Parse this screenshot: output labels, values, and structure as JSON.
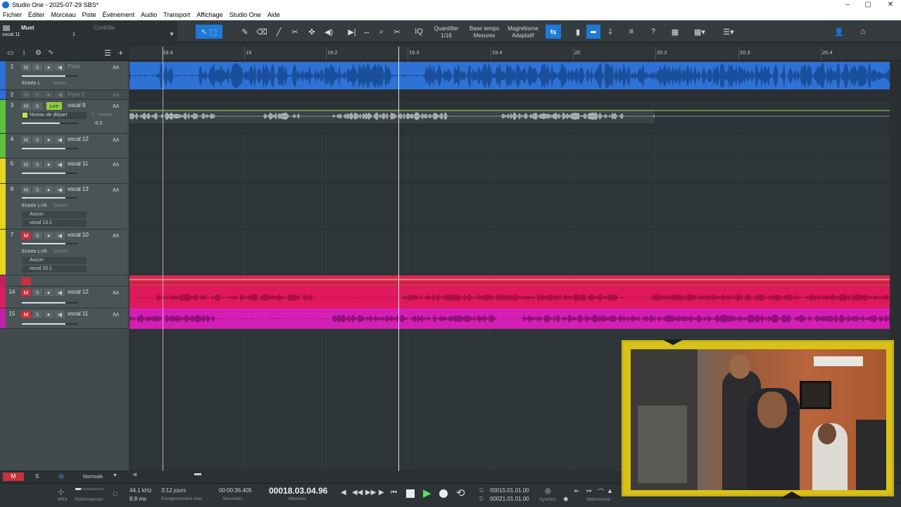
{
  "window": {
    "title": "Studio One - 2025-07-29 SBS*",
    "minimize": "–",
    "maximize": "▢",
    "close": "✕"
  },
  "menu": [
    "Fichier",
    "Éditer",
    "Morceau",
    "Piste",
    "Événement",
    "Audio",
    "Transport",
    "Affichage",
    "Studio One",
    "Aide"
  ],
  "track_selector": {
    "mute_label": "Muet",
    "track_name": "vocal 11",
    "count": "1",
    "controle": "Contrôle"
  },
  "toolbar": {
    "quantize_label": "Quantifier",
    "quantize_value": "1/16",
    "timebase_label": "Base temps",
    "timebase_value": "Mesures",
    "snap_label": "Magnétisme",
    "snap_value": "Adaptatif",
    "iq": "IQ",
    "help": "?"
  },
  "ruler": [
    "18.4",
    "19",
    "19.2",
    "19.3",
    "19.4",
    "20",
    "20.2",
    "20.3",
    "20.4"
  ],
  "tracks": [
    {
      "num": "1",
      "name": "Piste",
      "color": "#2d6fd8",
      "sub": "Entrée L",
      "mode": "Mono"
    },
    {
      "num": "2",
      "name": "Piste 2",
      "color": "#2d6fd8"
    },
    {
      "num": "3",
      "name": "vocal 9",
      "color": "#5bc23b",
      "lire": "Lire",
      "send": "Niveau de départ",
      "send_target": "1 - reverb",
      "value": "-8.3"
    },
    {
      "num": "4",
      "name": "vocal 12",
      "color": "#5bc23b"
    },
    {
      "num": "5",
      "name": "vocal 11",
      "color": "#e6d41f"
    },
    {
      "num": "6",
      "name": "vocal 13",
      "color": "#e6d41f",
      "sub": "Entrée L+R",
      "mode": "Stéréo",
      "out": "Aucun",
      "playlist": "vocal 13.1"
    },
    {
      "num": "7",
      "name": "vocal 10",
      "color": "#e6d41f",
      "sub": "Entrée L+R",
      "mode": "Stéréo",
      "out": "Aucun",
      "playlist": "vocal 10.1"
    },
    {
      "num": "14",
      "name": "vocal 12",
      "color": "#d81d63"
    },
    {
      "num": "15",
      "name": "vocal 11",
      "color": "#c21fa8"
    }
  ],
  "bottom_left": {
    "m": "M",
    "s": "S",
    "mode": "Normale"
  },
  "transport": {
    "midi": "MIDI",
    "performances": "Performances",
    "sample_rate": "44.1 kHz",
    "latency": "8.8 ms",
    "record_days": "3:12 jours",
    "record_label": "Enregistrement max.",
    "seconds_value": "00:00:36.405",
    "seconds_label": "Secondes",
    "bars_value": "00018.03.04.96",
    "bars_label": "Mesures",
    "loop_start": "00015.01.01.00",
    "loop_end": "00021.01.01.00",
    "loop_g": "G",
    "loop_d": "D",
    "sync_label": "Synchro",
    "metronome_label": "Métronome"
  }
}
